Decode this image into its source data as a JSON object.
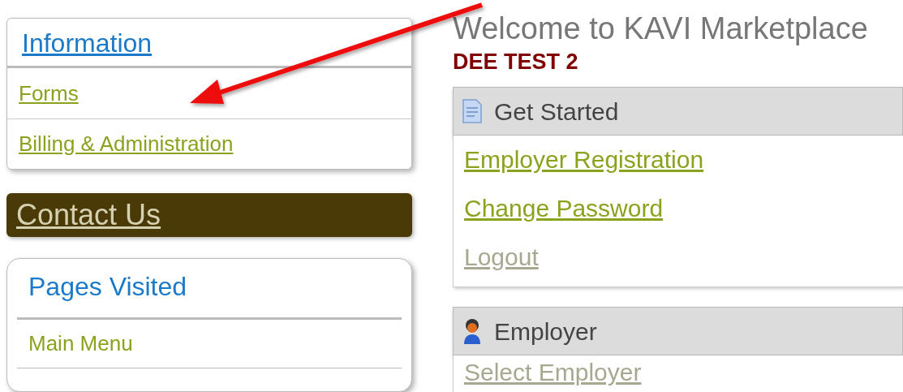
{
  "information": {
    "title": "Information",
    "links": [
      {
        "label": "Forms"
      },
      {
        "label": "Billing & Administration"
      }
    ]
  },
  "contact": {
    "label": "Contact Us"
  },
  "pages_visited": {
    "title": "Pages Visited",
    "links": [
      {
        "label": "Main Menu"
      }
    ]
  },
  "welcome": {
    "title": "Welcome to KAVI Marketplace",
    "subtitle": "DEE TEST 2"
  },
  "panels": [
    {
      "title": "Get Started",
      "kind": "document",
      "links": [
        {
          "label": "Employer Registration",
          "muted": false
        },
        {
          "label": "Change Password",
          "muted": false
        },
        {
          "label": "Logout",
          "muted": true
        }
      ]
    },
    {
      "title": "Employer",
      "kind": "person",
      "links": [
        {
          "label": "Select Employer",
          "muted": true
        }
      ]
    }
  ]
}
